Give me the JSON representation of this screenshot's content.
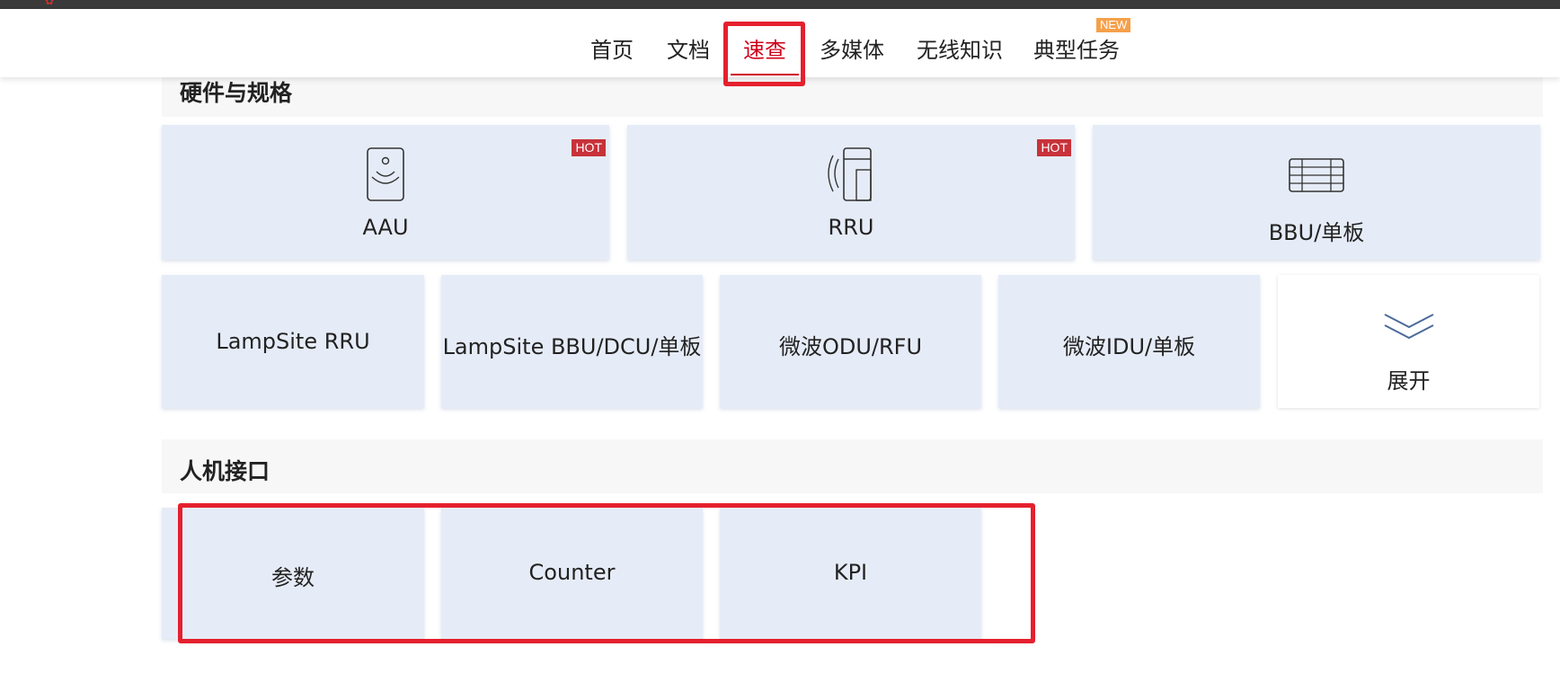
{
  "nav": {
    "items": [
      {
        "label": "首页"
      },
      {
        "label": "文档"
      },
      {
        "label": "速查"
      },
      {
        "label": "多媒体"
      },
      {
        "label": "无线知识"
      },
      {
        "label": "典型任务"
      }
    ],
    "new_badge": "NEW",
    "accent": "#d0021b"
  },
  "hardware": {
    "title": "硬件与规格",
    "hot_badge": "HOT",
    "tiles_row1": [
      {
        "label": "AAU",
        "hot": true,
        "icon": "aau-icon"
      },
      {
        "label": "RRU",
        "hot": true,
        "icon": "rru-icon"
      },
      {
        "label": "BBU/单板",
        "hot": false,
        "icon": "bbu-icon"
      }
    ],
    "tiles_row2": [
      {
        "label": "LampSite RRU"
      },
      {
        "label": "LampSite BBU/DCU/单板"
      },
      {
        "label": "微波ODU/RFU"
      },
      {
        "label": "微波IDU/单板"
      }
    ],
    "expand_label": "展开"
  },
  "hmi": {
    "title": "人机接口",
    "tiles": [
      {
        "label": "参数"
      },
      {
        "label": "Counter"
      },
      {
        "label": "KPI"
      }
    ]
  },
  "colors": {
    "tile_bg": "#e6ecf7",
    "highlight_box": "#e5202e",
    "hot_badge": "#c8323a",
    "new_badge": "#f5a04a"
  }
}
